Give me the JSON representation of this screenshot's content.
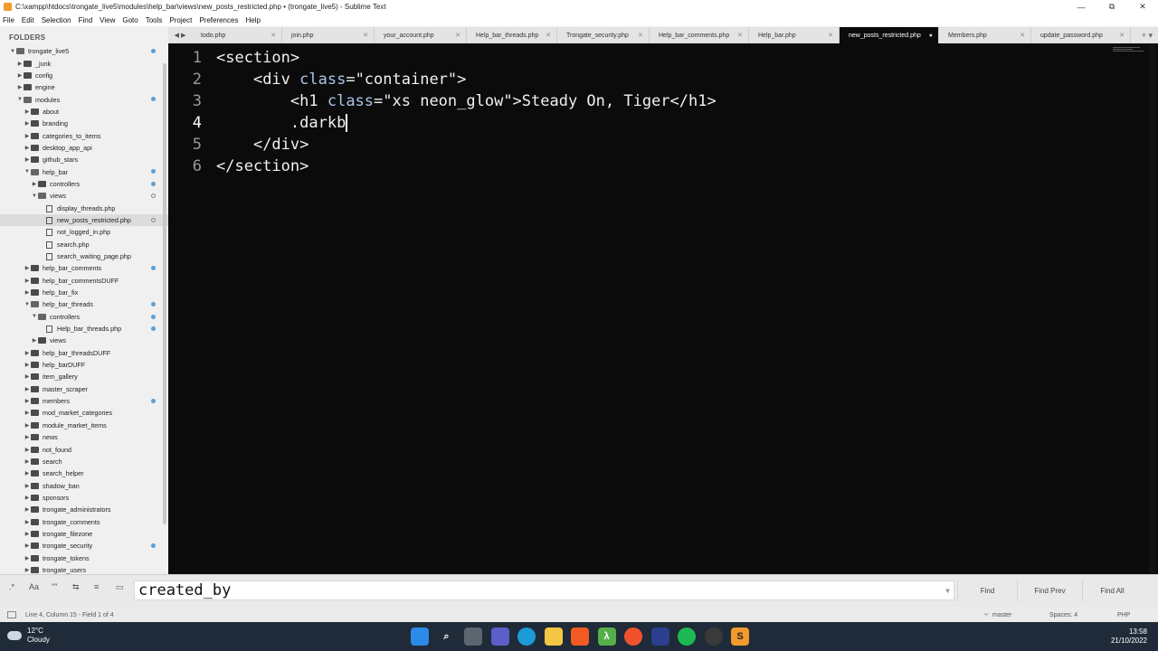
{
  "window": {
    "title": "C:\\xampp\\htdocs\\trongate_live5\\modules\\help_bar\\views\\new_posts_restricted.php • (trongate_live5) - Sublime Text",
    "minimize": "—",
    "maximize": "⧉",
    "close": "✕"
  },
  "menu": [
    "File",
    "Edit",
    "Selection",
    "Find",
    "View",
    "Goto",
    "Tools",
    "Project",
    "Preferences",
    "Help"
  ],
  "sidebar": {
    "header": "FOLDERS",
    "items": [
      {
        "label": "trongate_live5",
        "depth": 0,
        "type": "folder-open",
        "dot": "filled"
      },
      {
        "label": "_junk",
        "depth": 1,
        "type": "folder",
        "dot": ""
      },
      {
        "label": "config",
        "depth": 1,
        "type": "folder",
        "dot": ""
      },
      {
        "label": "engine",
        "depth": 1,
        "type": "folder",
        "dot": ""
      },
      {
        "label": "modules",
        "depth": 1,
        "type": "folder-open",
        "dot": "filled"
      },
      {
        "label": "about",
        "depth": 2,
        "type": "folder",
        "dot": ""
      },
      {
        "label": "branding",
        "depth": 2,
        "type": "folder",
        "dot": ""
      },
      {
        "label": "categories_to_items",
        "depth": 2,
        "type": "folder",
        "dot": ""
      },
      {
        "label": "desktop_app_api",
        "depth": 2,
        "type": "folder",
        "dot": ""
      },
      {
        "label": "github_stars",
        "depth": 2,
        "type": "folder",
        "dot": ""
      },
      {
        "label": "help_bar",
        "depth": 2,
        "type": "folder-open",
        "dot": "filled"
      },
      {
        "label": "controllers",
        "depth": 3,
        "type": "folder",
        "dot": "filled"
      },
      {
        "label": "views",
        "depth": 3,
        "type": "folder-open",
        "dot": "hollow"
      },
      {
        "label": "display_threads.php",
        "depth": 4,
        "type": "file",
        "dot": ""
      },
      {
        "label": "new_posts_restricted.php",
        "depth": 4,
        "type": "file",
        "dot": "hollow",
        "selected": true
      },
      {
        "label": "not_logged_in.php",
        "depth": 4,
        "type": "file",
        "dot": ""
      },
      {
        "label": "search.php",
        "depth": 4,
        "type": "file",
        "dot": ""
      },
      {
        "label": "search_waiting_page.php",
        "depth": 4,
        "type": "file",
        "dot": ""
      },
      {
        "label": "help_bar_comments",
        "depth": 2,
        "type": "folder",
        "dot": "filled"
      },
      {
        "label": "help_bar_commentsDUFF",
        "depth": 2,
        "type": "folder",
        "dot": ""
      },
      {
        "label": "help_bar_fix",
        "depth": 2,
        "type": "folder",
        "dot": ""
      },
      {
        "label": "help_bar_threads",
        "depth": 2,
        "type": "folder-open",
        "dot": "filled"
      },
      {
        "label": "controllers",
        "depth": 3,
        "type": "folder-open",
        "dot": "filled"
      },
      {
        "label": "Help_bar_threads.php",
        "depth": 4,
        "type": "file",
        "dot": "filled"
      },
      {
        "label": "views",
        "depth": 3,
        "type": "folder",
        "dot": ""
      },
      {
        "label": "help_bar_threadsDUFF",
        "depth": 2,
        "type": "folder",
        "dot": ""
      },
      {
        "label": "help_barDUFF",
        "depth": 2,
        "type": "folder",
        "dot": ""
      },
      {
        "label": "item_gallery",
        "depth": 2,
        "type": "folder",
        "dot": ""
      },
      {
        "label": "master_scraper",
        "depth": 2,
        "type": "folder",
        "dot": ""
      },
      {
        "label": "members",
        "depth": 2,
        "type": "folder",
        "dot": "filled"
      },
      {
        "label": "mod_market_categories",
        "depth": 2,
        "type": "folder",
        "dot": ""
      },
      {
        "label": "module_market_items",
        "depth": 2,
        "type": "folder",
        "dot": ""
      },
      {
        "label": "news",
        "depth": 2,
        "type": "folder",
        "dot": ""
      },
      {
        "label": "not_found",
        "depth": 2,
        "type": "folder",
        "dot": ""
      },
      {
        "label": "search",
        "depth": 2,
        "type": "folder",
        "dot": ""
      },
      {
        "label": "search_helper",
        "depth": 2,
        "type": "folder",
        "dot": ""
      },
      {
        "label": "shadow_ban",
        "depth": 2,
        "type": "folder",
        "dot": ""
      },
      {
        "label": "sponsors",
        "depth": 2,
        "type": "folder",
        "dot": ""
      },
      {
        "label": "trongate_administrators",
        "depth": 2,
        "type": "folder",
        "dot": ""
      },
      {
        "label": "trongate_comments",
        "depth": 2,
        "type": "folder",
        "dot": ""
      },
      {
        "label": "trongate_filezone",
        "depth": 2,
        "type": "folder",
        "dot": ""
      },
      {
        "label": "trongate_security",
        "depth": 2,
        "type": "folder",
        "dot": "filled"
      },
      {
        "label": "trongate_tokens",
        "depth": 2,
        "type": "folder",
        "dot": ""
      },
      {
        "label": "trongate_users",
        "depth": 2,
        "type": "folder",
        "dot": ""
      }
    ]
  },
  "tabs": [
    {
      "label": "todo.php",
      "active": false
    },
    {
      "label": "join.php",
      "active": false
    },
    {
      "label": "your_account.php",
      "active": false
    },
    {
      "label": "Help_bar_threads.php",
      "active": false
    },
    {
      "label": "Trongate_security.php",
      "active": false
    },
    {
      "label": "Help_bar_comments.php",
      "active": false
    },
    {
      "label": "Help_bar.php",
      "active": false
    },
    {
      "label": "new_posts_restricted.php",
      "active": true
    },
    {
      "label": "Members.php",
      "active": false
    },
    {
      "label": "update_password.php",
      "active": false
    }
  ],
  "editor": {
    "lines": [
      {
        "n": "1",
        "indent": "",
        "parts": [
          [
            "tag",
            "<section>"
          ]
        ]
      },
      {
        "n": "2",
        "indent": "    ",
        "parts": [
          [
            "tag",
            "<div "
          ],
          [
            "attr",
            "class"
          ],
          [
            "tag",
            "=\"container\">"
          ]
        ]
      },
      {
        "n": "3",
        "indent": "        ",
        "parts": [
          [
            "tag",
            "<h1 "
          ],
          [
            "attr",
            "class"
          ],
          [
            "tag",
            "=\"xs neon_glow\">Steady On, Tiger</h1>"
          ]
        ]
      },
      {
        "n": "4",
        "indent": "        ",
        "parts": [
          [
            "tag",
            ".darkb"
          ]
        ],
        "cursor": true
      },
      {
        "n": "5",
        "indent": "    ",
        "parts": [
          [
            "tag",
            "</div>"
          ]
        ]
      },
      {
        "n": "6",
        "indent": "",
        "parts": [
          [
            "tag",
            "</section>"
          ]
        ]
      }
    ]
  },
  "find": {
    "regex": ".*",
    "case": "Aa",
    "word": "\"\"",
    "wrap": "⇆",
    "in_selection": "≡",
    "highlight": "▭",
    "value": "created_by",
    "find_label": "Find",
    "find_prev_label": "Find Prev",
    "find_all_label": "Find All"
  },
  "status": {
    "position": "Line 4, Column 15 - Field 1 of 4",
    "branch": "master",
    "spaces": "Spaces: 4",
    "syntax": "PHP"
  },
  "taskbar": {
    "temp": "12°C",
    "weather": "Cloudy",
    "time": "13:58",
    "date": "21/10/2022"
  }
}
